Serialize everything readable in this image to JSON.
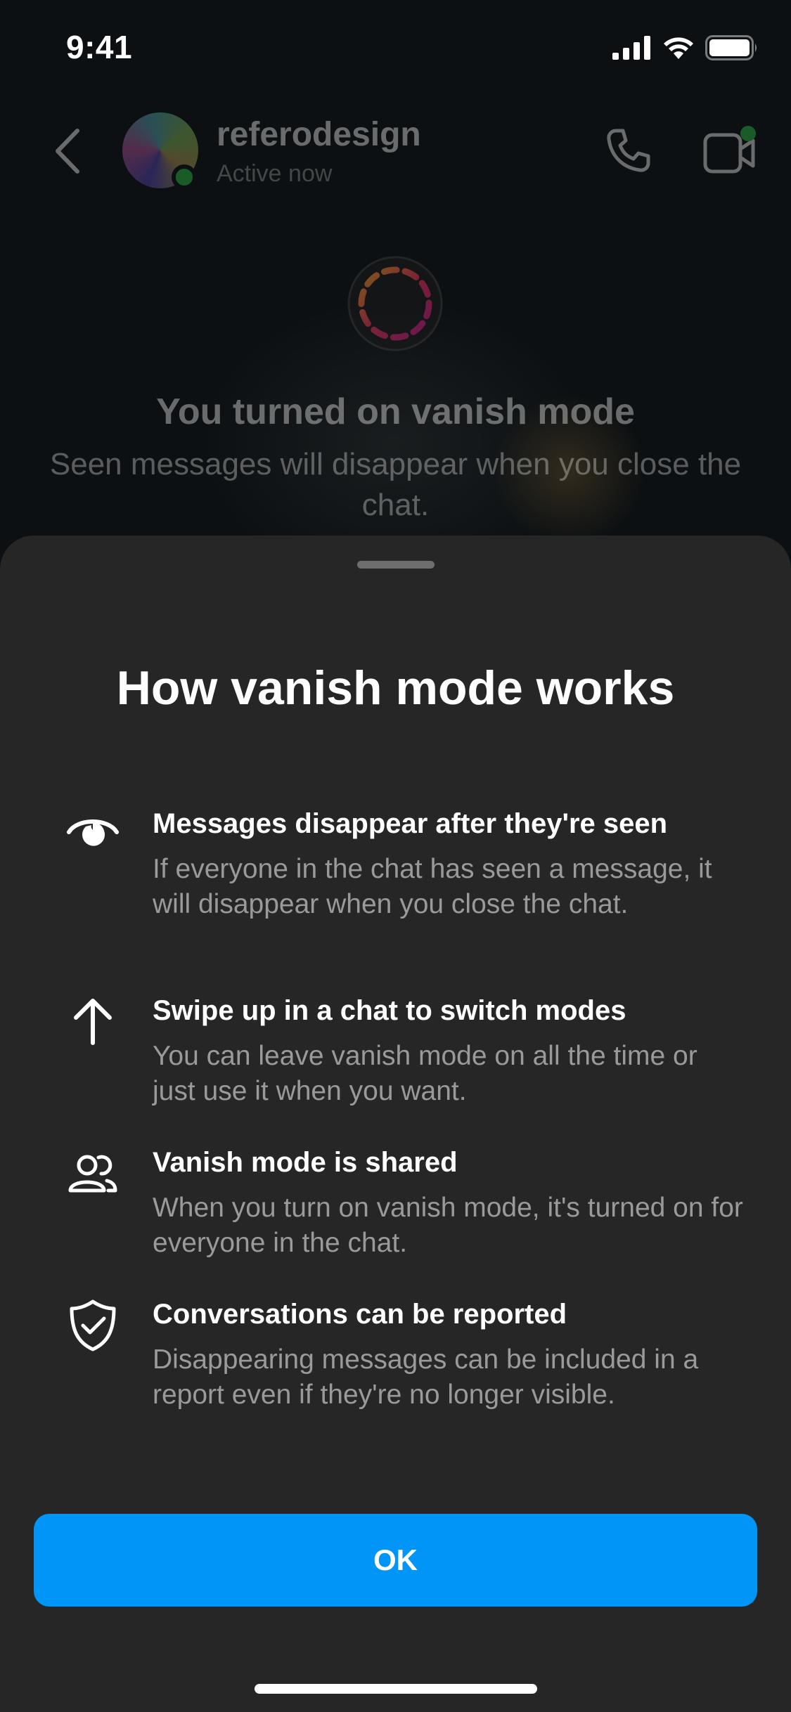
{
  "status_bar": {
    "time": "9:41"
  },
  "chat_header": {
    "contact_name": "referodesign",
    "contact_status": "Active now"
  },
  "vanish_notice": {
    "title": "You turned on vanish mode",
    "description": "Seen messages will disappear when you close the chat."
  },
  "sheet": {
    "title": "How vanish mode works",
    "features": [
      {
        "icon": "eye-half-icon",
        "title": "Messages disappear after they're seen",
        "description": "If everyone in the chat has seen a message, it will disappear when you close the chat."
      },
      {
        "icon": "arrow-up-icon",
        "title": "Swipe up in a chat to switch modes",
        "description": "You can leave vanish mode on all the time or just use it when you want."
      },
      {
        "icon": "people-icon",
        "title": "Vanish mode is shared",
        "description": "When you turn on vanish mode, it's turned on for everyone in the chat."
      },
      {
        "icon": "shield-check-icon",
        "title": "Conversations can be reported",
        "description": "Disappearing messages can be included in a report even if they're no longer visible."
      }
    ],
    "ok_label": "OK"
  },
  "colors": {
    "accent": "#0095f6",
    "sheet_background": "#262626",
    "online_dot": "#32d74b"
  }
}
